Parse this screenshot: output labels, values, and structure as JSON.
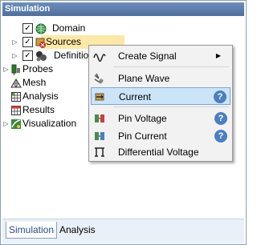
{
  "panel": {
    "title": "Simulation"
  },
  "tree": {
    "items": [
      {
        "label": "Domain",
        "icon": "globe-icon",
        "checked": true
      },
      {
        "label": "Sources",
        "icon": "sources-icon",
        "checked": true,
        "selected": true
      },
      {
        "label": "Definitions",
        "icon": "definitions-icon",
        "checked": true
      },
      {
        "label": "Probes",
        "icon": "probes-icon"
      },
      {
        "label": "Mesh",
        "icon": "mesh-icon"
      },
      {
        "label": "Analysis",
        "icon": "analysis-icon"
      },
      {
        "label": "Results",
        "icon": "results-icon"
      },
      {
        "label": "Visualization",
        "icon": "visualization-icon"
      }
    ]
  },
  "context_menu": {
    "items": [
      {
        "label": "Create Signal",
        "icon": "signal-icon",
        "submenu": true
      },
      {
        "label": "Plane Wave",
        "icon": "plane-wave-icon"
      },
      {
        "label": "Current",
        "icon": "current-icon",
        "highlighted": true,
        "help": "?"
      },
      {
        "label": "Pin Voltage",
        "icon": "pin-voltage-icon",
        "help": "?"
      },
      {
        "label": "Pin Current",
        "icon": "pin-current-icon",
        "help": "?"
      },
      {
        "label": "Differential Voltage",
        "icon": "differential-voltage-icon"
      }
    ],
    "submenu_arrow": "▶"
  },
  "tabs": [
    {
      "label": "Simulation",
      "active": true
    },
    {
      "label": "Analysis",
      "active": false
    }
  ],
  "colors": {
    "title_bar": "#5b7cab",
    "selection": "#fde9a6",
    "menu_highlight": "#cce4f7",
    "help_icon": "#4a7fc1"
  }
}
